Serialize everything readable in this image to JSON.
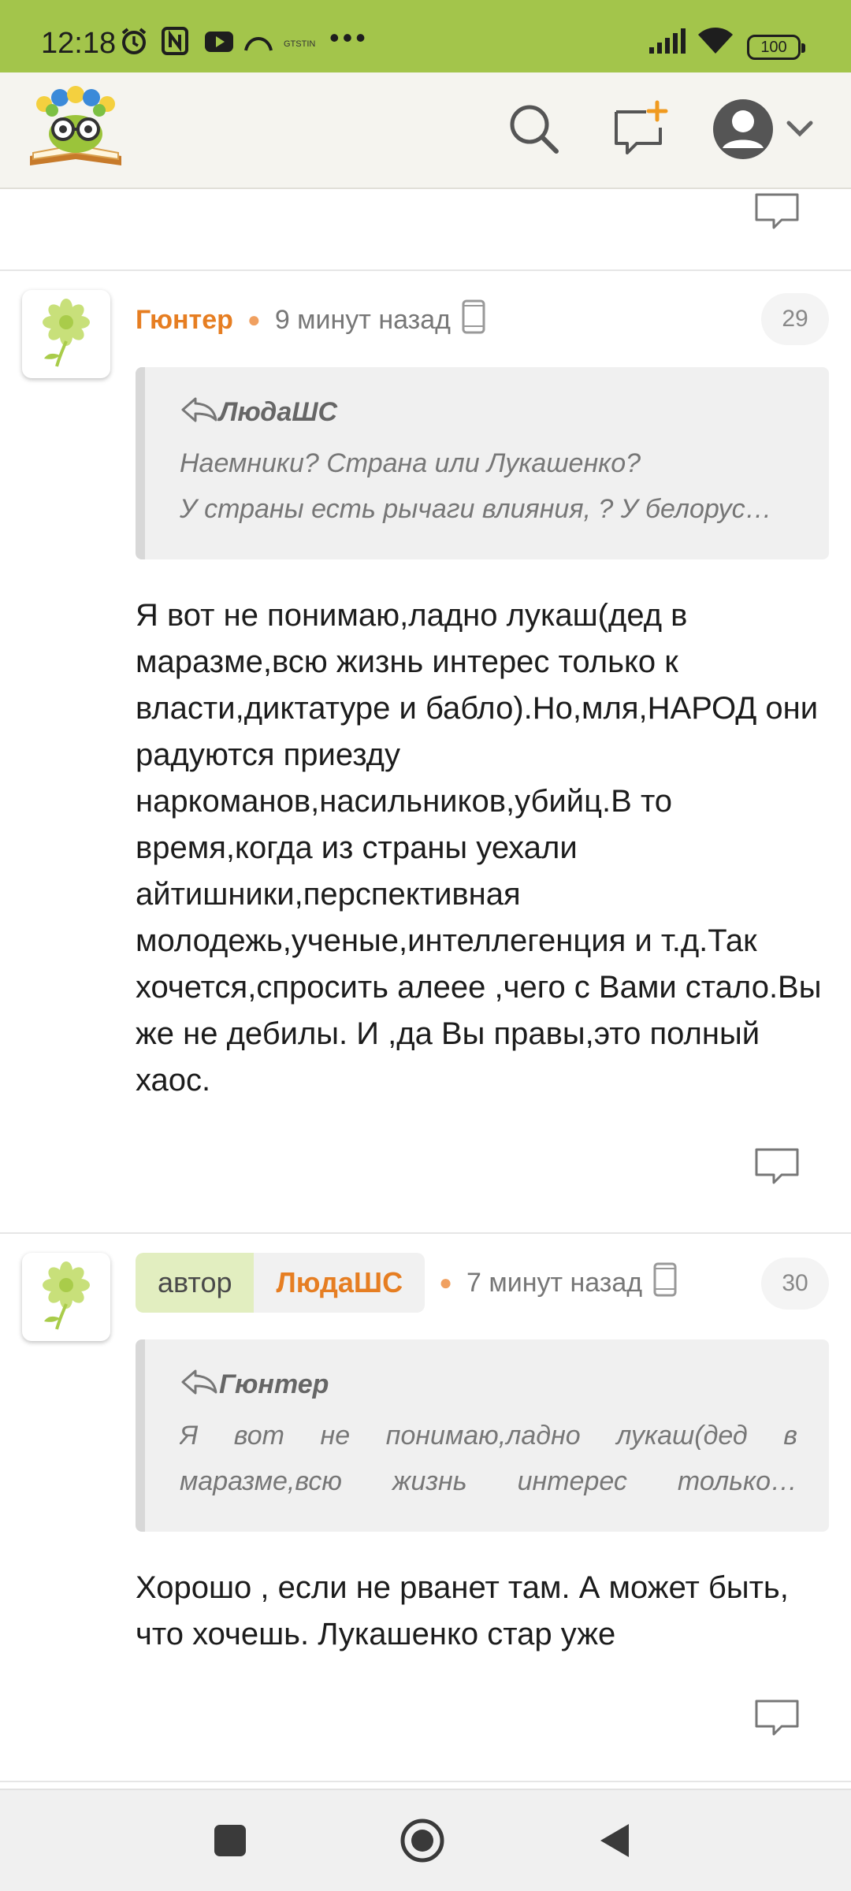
{
  "status_bar": {
    "time": "12:18",
    "mini_text": "GTSTIN",
    "dots": "•••",
    "battery": "100"
  },
  "header": {
    "logo_icon": "reading-book-mascot-logo",
    "search_icon": "search-icon",
    "new_post_icon": "new-message-icon",
    "profile_icon": "user-avatar-icon"
  },
  "colors": {
    "status_bar": "#a3c54b",
    "username": "#e67e22",
    "author_tag": "#e2eec0"
  },
  "comments": [
    {
      "username": "Гюнтер",
      "time": "9 минут назад",
      "number": "29",
      "quote_author": "ЛюдаШС",
      "quote_line1": "Наемники? Страна или Лукашенко?",
      "quote_line2": "У страны есть рычаги влияния, ? У белорус…",
      "text": "Я вот не понимаю,ладно лукаш(дед в маразме,всю жизнь интерес только к власти,диктатуре и бабло).Но,мля,НАРОД они радуются приезду наркоманов,насильников,убийц.В то время,когда из страны уехали айтишники,перспективная молодежь,ученые,интеллегенция и т.д.Так хочется,спросить алеее ,чего с Вами стало.Вы же не дебилы. И ,да Вы правы,это полный хаос."
    },
    {
      "author_tag": "автор",
      "username": "ЛюдаШС",
      "time": "7 минут назад",
      "number": "30",
      "quote_author": "Гюнтер",
      "quote_line1": "Я вот не понимаю,ладно лукаш(дед в",
      "quote_line2": "маразме,всю жизнь интерес только…",
      "text": "Хорошо , если не рванет там. А может быть, что хочешь. Лукашенко стар уже"
    }
  ]
}
